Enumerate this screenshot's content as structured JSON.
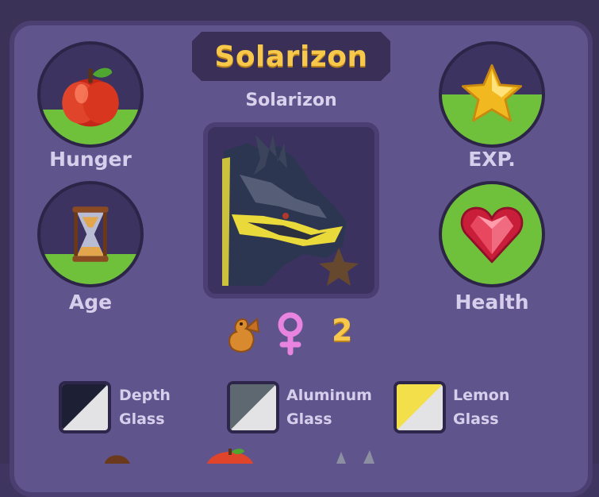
{
  "creature": {
    "name_plate": "Solarizon",
    "name": "Solarizon",
    "trait_count": "2"
  },
  "stats": {
    "hunger": {
      "label": "Hunger",
      "icon": "apple-icon",
      "level": 0.35
    },
    "age": {
      "label": "Age",
      "icon": "hourglass-icon",
      "level": 0.3
    },
    "exp": {
      "label": "EXP.",
      "icon": "star-icon",
      "level": 0.5
    },
    "health": {
      "label": "Health",
      "icon": "heart-gem-icon",
      "level": 1.0
    }
  },
  "traits": {
    "icons": [
      "dragon-icon",
      "female-symbol-icon"
    ]
  },
  "colors": {
    "primary": {
      "line1": "Depth",
      "line2": "Glass",
      "dark": "#1d2034",
      "light": "#e3e3e5"
    },
    "secondary": {
      "line1": "Aluminum",
      "line2": "Glass",
      "dark": "#5d6871",
      "light": "#e3e3e5"
    },
    "tertiary": {
      "line1": "Lemon",
      "line2": "Glass",
      "dark": "#f3df49",
      "light": "#e3e3e5"
    }
  },
  "theme": {
    "panel": "#60548c",
    "meter_green": "#6fc03a",
    "gold_text": "#f7c84a"
  }
}
